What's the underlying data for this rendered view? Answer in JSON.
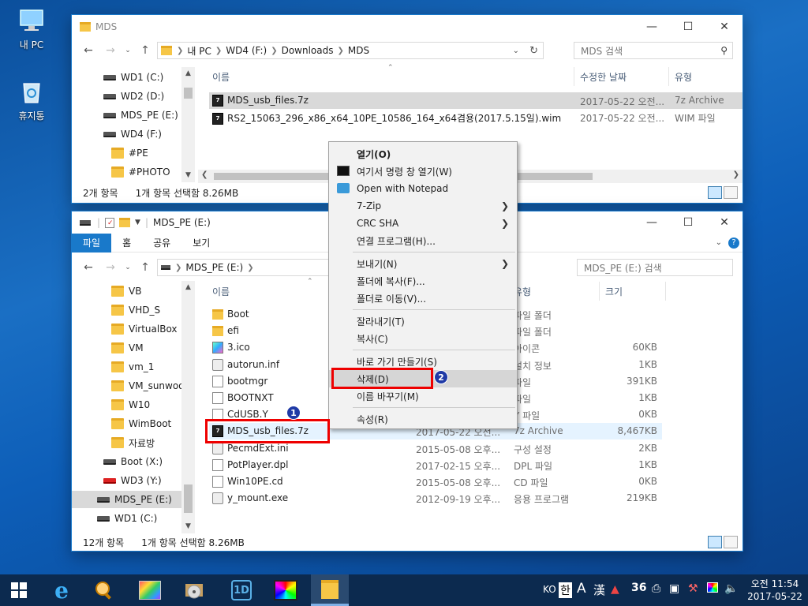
{
  "desktop": {
    "icons": [
      {
        "label": "내 PC"
      },
      {
        "label": "휴지통"
      }
    ]
  },
  "win1": {
    "title": "MDS",
    "address": [
      "내 PC",
      "WD4 (F:)",
      "Downloads",
      "MDS"
    ],
    "search_placeholder": "MDS 검색",
    "tree": [
      {
        "label": "WD1 (C:)",
        "type": "drive"
      },
      {
        "label": "WD2 (D:)",
        "type": "drive"
      },
      {
        "label": "MDS_PE (E:)",
        "type": "drive"
      },
      {
        "label": "WD4 (F:)",
        "type": "drive"
      },
      {
        "label": "#PE",
        "type": "folder"
      },
      {
        "label": "#PHOTO",
        "type": "folder"
      }
    ],
    "columns": {
      "name": "이름",
      "modified": "수정한 날짜",
      "type": "유형"
    },
    "files": [
      {
        "name": "MDS_usb_files.7z",
        "modified": "2017-05-22 오전...",
        "type": "7z Archive"
      },
      {
        "name": "RS2_15063_296_x86_x64_10PE_10586_164_x64겸용(2017.5.15일).wim",
        "modified": "2017-05-22 오전...",
        "type": "WIM 파일"
      }
    ],
    "status_count": "2개 항목",
    "status_selected": "1개 항목 선택함 8.26MB"
  },
  "win2": {
    "title": "MDS_PE (E:)",
    "ribbon_tabs": [
      "파일",
      "홈",
      "공유",
      "보기"
    ],
    "address": [
      "MDS_PE (E:)"
    ],
    "search_placeholder": "MDS_PE (E:) 검색",
    "tree": [
      {
        "label": "VB",
        "type": "folder"
      },
      {
        "label": "VHD_S",
        "type": "folder"
      },
      {
        "label": "VirtualBox",
        "type": "folder"
      },
      {
        "label": "VM",
        "type": "folder"
      },
      {
        "label": "vm_1",
        "type": "folder"
      },
      {
        "label": "VM_sunwoo",
        "type": "folder"
      },
      {
        "label": "W10",
        "type": "folder"
      },
      {
        "label": "WimBoot",
        "type": "folder"
      },
      {
        "label": "자료방",
        "type": "folder"
      },
      {
        "label": "Boot (X:)",
        "type": "drive"
      },
      {
        "label": "WD3 (Y:)",
        "type": "reddrive"
      },
      {
        "label": "MDS_PE (E:)",
        "type": "drive"
      },
      {
        "label": "WD1 (C:)",
        "type": "drive"
      }
    ],
    "columns": {
      "name": "이름",
      "type": "유형",
      "size": "크기"
    },
    "files": [
      {
        "name": "Boot",
        "modified": "",
        "type": "파일 폴더",
        "size": "",
        "icon": "fold"
      },
      {
        "name": "efi",
        "modified": "",
        "type": "파일 폴더",
        "size": "",
        "icon": "fold"
      },
      {
        "name": "3.ico",
        "modified": "",
        "type": "아이콘",
        "size": "60KB",
        "icon": "img"
      },
      {
        "name": "autorun.inf",
        "modified": "",
        "type": "설치 정보",
        "size": "1KB",
        "icon": "cog"
      },
      {
        "name": "bootmgr",
        "modified": "",
        "type": "파일",
        "size": "391KB",
        "icon": "doc"
      },
      {
        "name": "BOOTNXT",
        "modified": "",
        "type": "파일",
        "size": "1KB",
        "icon": "doc"
      },
      {
        "name": "CdUSB.Y",
        "modified": "",
        "type": "Y 파일",
        "size": "0KB",
        "icon": "doc"
      },
      {
        "name": "MDS_usb_files.7z",
        "modified": "2017-05-22 오전...",
        "type": "7z Archive",
        "size": "8,467KB",
        "icon": "7z"
      },
      {
        "name": "PecmdExt.ini",
        "modified": "2015-05-08 오후...",
        "type": "구성 설정",
        "size": "2KB",
        "icon": "cog"
      },
      {
        "name": "PotPlayer.dpl",
        "modified": "2017-02-15 오후...",
        "type": "DPL 파일",
        "size": "1KB",
        "icon": "doc"
      },
      {
        "name": "Win10PE.cd",
        "modified": "2015-05-08 오후...",
        "type": "CD 파일",
        "size": "0KB",
        "icon": "doc"
      },
      {
        "name": "y_mount.exe",
        "modified": "2012-09-19 오후...",
        "type": "응용 프로그램",
        "size": "219KB",
        "icon": "cog"
      }
    ],
    "status_count": "12개 항목",
    "status_selected": "1개 항목 선택함 8.26MB"
  },
  "context_menu": [
    {
      "label": "열기(O)",
      "bold": true
    },
    {
      "label": "여기서 명령 창 열기(W)",
      "icon": "cmd"
    },
    {
      "label": "Open with Notepad",
      "icon": "notepad"
    },
    {
      "label": "7-Zip",
      "submenu": true
    },
    {
      "label": "CRC SHA",
      "submenu": true
    },
    {
      "label": "연결 프로그램(H)..."
    },
    {
      "sep": true
    },
    {
      "label": "보내기(N)",
      "submenu": true
    },
    {
      "label": "폴더에 복사(F)..."
    },
    {
      "label": "폴더로 이동(V)..."
    },
    {
      "sep": true
    },
    {
      "label": "잘라내기(T)"
    },
    {
      "label": "복사(C)"
    },
    {
      "sep": true
    },
    {
      "label": "바로 가기 만들기(S)"
    },
    {
      "label": "삭제(D)",
      "highlighted": true
    },
    {
      "label": "이름 바꾸기(M)"
    },
    {
      "sep": true
    },
    {
      "label": "속성(R)"
    }
  ],
  "annotations": {
    "badge1": "1",
    "badge2": "2"
  },
  "taskbar": {
    "apps": [
      "start",
      "internet-explorer",
      "search-tool",
      "image-viewer",
      "media-disc",
      "ten-app",
      "color-app",
      "file-explorer"
    ],
    "tray_lang": "KO",
    "tray_ime": "한",
    "tray_a": "A",
    "tray_han": "漢",
    "tray_36": "36",
    "time": "오전 11:54",
    "date": "2017-05-22"
  },
  "colors": {
    "accent": "#1979ca",
    "selection": "#e5f3ff",
    "highlight_red": "#e00000",
    "badge": "#1f3aa6"
  }
}
